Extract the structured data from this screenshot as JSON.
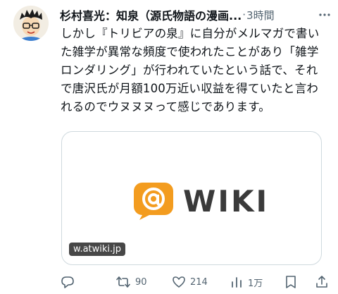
{
  "post": {
    "author": "杉村喜光：知泉（源氏物語の漫画...",
    "separator": "·",
    "time": "3時間",
    "text": "しかし『トリビアの泉』に自分がメルマガで書いた雑学が異常な頻度で使われたことがあり「雑学ロンダリング」が行われていたという話で、それで唐沢氏が月額100万近い収益を得ていたと言われるのでウヌヌヌって感じであります。"
  },
  "card": {
    "logo_text": "WIKI",
    "domain": "w.atwiki.jp"
  },
  "actions": {
    "replies": "",
    "retweets": "90",
    "likes": "214",
    "views": "1万"
  },
  "colors": {
    "logo_orange": "#f39c1f",
    "muted": "#536471"
  },
  "icons": [
    "more-icon",
    "reply-icon",
    "retweet-icon",
    "like-icon",
    "views-icon",
    "bookmark-icon",
    "share-icon"
  ]
}
